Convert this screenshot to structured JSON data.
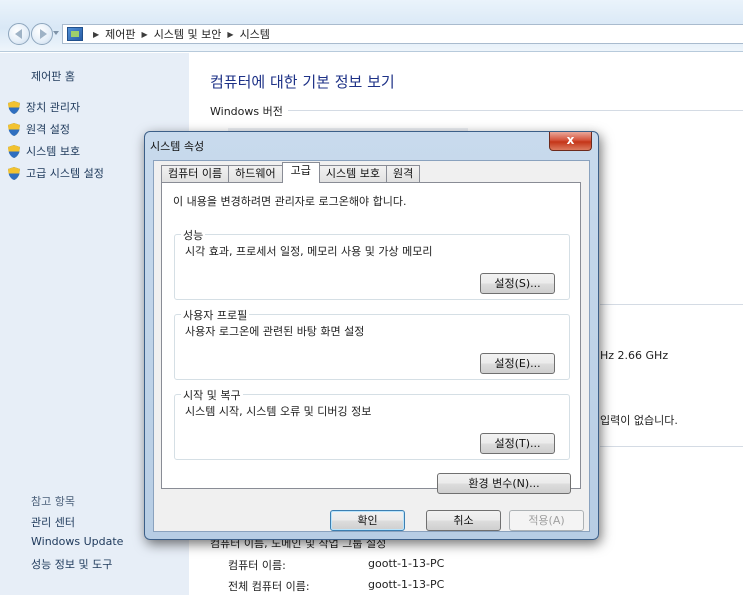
{
  "address": {
    "crumbs": [
      "제어판",
      "시스템 및 보안",
      "시스템"
    ]
  },
  "leftnav": {
    "home": "제어판 홈",
    "links": [
      "장치 관리자",
      "원격 설정",
      "시스템 보호",
      "고급 시스템 설정"
    ],
    "see_also": "참고 항목",
    "bottom_links": [
      "관리 센터",
      "Windows Update",
      "성능 정보 및 도구"
    ]
  },
  "main": {
    "title": "컴퓨터에 대한 기본 정보 보기",
    "windows_edition_head": "Windows 버전",
    "processor_speed_fragment": "Hz   2.66 GHz",
    "pen_touch_fragment": "입력이 없습니다.",
    "computer_name_head_partial": "컴퓨터 이름, 도메인 및 작업 그룹 설정",
    "computer_name_label": "컴퓨터 이름:",
    "computer_name_value": "goott-1-13-PC",
    "full_computer_name_label": "전체 컴퓨터 이름:",
    "full_computer_name_value": "goott-1-13-PC"
  },
  "dialog": {
    "title": "시스템 속성",
    "close_glyph": "x",
    "tabs": [
      "컴퓨터 이름",
      "하드웨어",
      "고급",
      "시스템 보호",
      "원격"
    ],
    "active_tab": "고급",
    "note": "이 내용을 변경하려면 관리자로 로그온해야 합니다.",
    "groups": [
      {
        "title": "성능",
        "desc": "시각 효과, 프로세서 일정, 메모리 사용 및 가상 메모리",
        "button": "설정(S)..."
      },
      {
        "title": "사용자 프로필",
        "desc": "사용자 로그온에 관련된 바탕 화면 설정",
        "button": "설정(E)..."
      },
      {
        "title": "시작 및 복구",
        "desc": "시스템 시작, 시스템 오류 및 디버깅 정보",
        "button": "설정(T)..."
      }
    ],
    "env_button": "환경 변수(N)...",
    "ok_button": "확인",
    "cancel_button": "취소",
    "apply_button": "적용(A)"
  },
  "colors": {
    "title_blue": "#1e3287",
    "nav_link": "#1e395b",
    "left_pane": "#e7eef7",
    "close_red": "#c43518"
  }
}
